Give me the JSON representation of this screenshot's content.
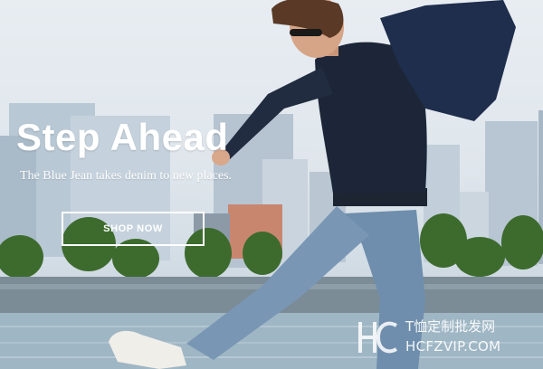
{
  "hero": {
    "headline": "Step Ahead",
    "tagline": "The Blue Jean takes denim to new places.",
    "cta_label": "SHOP NOW"
  },
  "watermark": {
    "line1": "T恤定制批发网",
    "line2": "HCFZVIP.COM"
  },
  "colors": {
    "text": "#ffffff",
    "sky": "#e3e9ee",
    "water": "#9fb6c4",
    "sweater": "#1c2638",
    "denim": "#6f8ead"
  }
}
